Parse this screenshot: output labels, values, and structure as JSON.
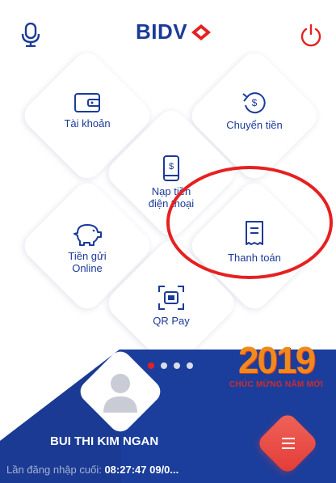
{
  "header": {
    "brand": "BIDV",
    "icons": {
      "mic": "microphone-icon",
      "power": "power-icon"
    }
  },
  "menu": {
    "items": [
      {
        "label": "Tài khoản",
        "icon": "wallet-icon"
      },
      {
        "label": "Chuyển tiền",
        "icon": "money-transfer-icon"
      },
      {
        "label": "Nạp tiền điện thoại",
        "line1": "Nạp tiền",
        "line2": "điện thoại",
        "icon": "phone-topup-icon"
      },
      {
        "label": "Tiền gửi Online",
        "line1": "Tiền gửi",
        "line2": "Online",
        "icon": "piggy-bank-icon"
      },
      {
        "label": "Thanh toán",
        "icon": "receipt-icon"
      },
      {
        "label": "QR Pay",
        "icon": "qr-scan-icon"
      }
    ]
  },
  "carousel": {
    "total": 4,
    "active_index": 0
  },
  "banner": {
    "year": "2019",
    "greeting": "CHÚC MỪNG NĂM MỚI"
  },
  "user": {
    "name": "BUI THI KIM NGAN",
    "last_login_label": "Lần đăng nhập cuối:",
    "last_login_value": "08:27:47 09/0..."
  },
  "colors": {
    "brand": "#1c3a99",
    "accent": "#e62020",
    "panel": "#1b3e9c"
  }
}
